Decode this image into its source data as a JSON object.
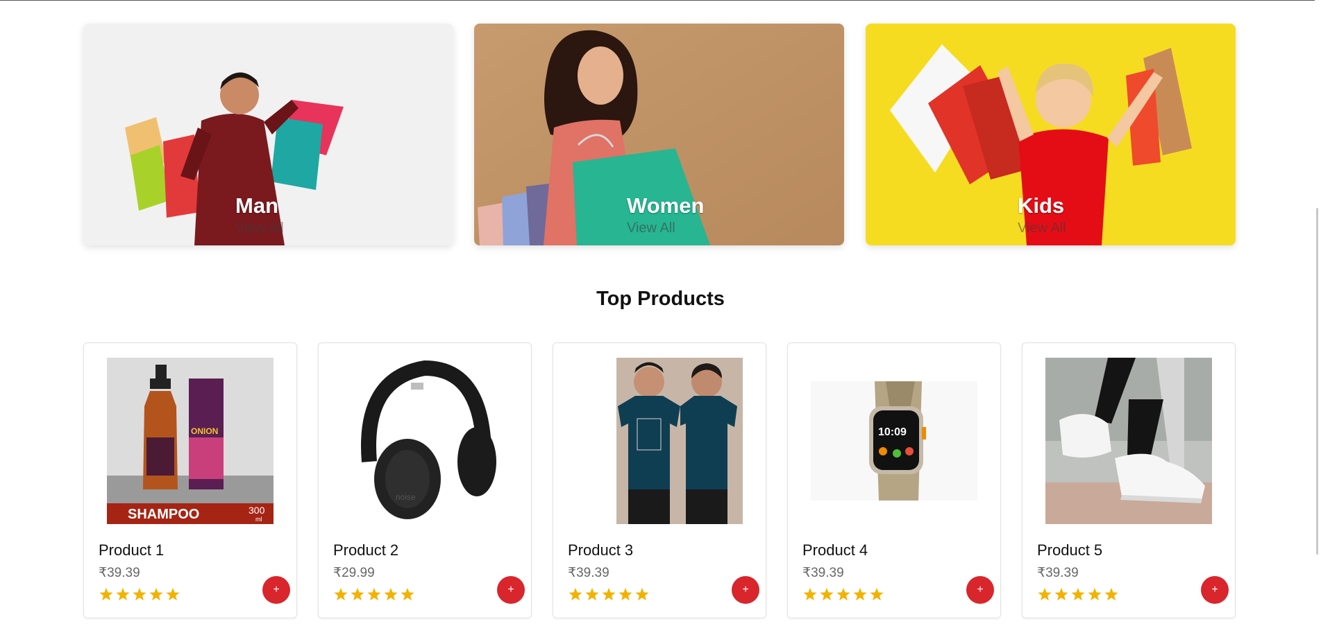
{
  "categories": [
    {
      "title": "Man",
      "link": "View All",
      "bg_color": "#f1f1f1"
    },
    {
      "title": "Women",
      "link": "View All",
      "bg_color": "#c69a6c"
    },
    {
      "title": "Kids",
      "link": "View All",
      "bg_color": "#f6dc21"
    }
  ],
  "section": {
    "title": "Top Products"
  },
  "products": [
    {
      "name": "Product 1",
      "price": "₹39.39",
      "rating": 5,
      "add_label": "+",
      "image_label": "SHAMPOO",
      "image_size": "300",
      "image_unit": "ml",
      "image_brand": "ONION",
      "image_icon": "shampoo-bottle-icon"
    },
    {
      "name": "Product 2",
      "price": "₹29.99",
      "rating": 5,
      "add_label": "+",
      "image_brand": "noise",
      "image_icon": "headphones-icon"
    },
    {
      "name": "Product 3",
      "price": "₹39.39",
      "rating": 5,
      "add_label": "+",
      "image_icon": "tshirt-icon"
    },
    {
      "name": "Product 4",
      "price": "₹39.39",
      "rating": 5,
      "add_label": "+",
      "image_time": "10:09",
      "image_icon": "smartwatch-icon"
    },
    {
      "name": "Product 5",
      "price": "₹39.39",
      "rating": 5,
      "add_label": "+",
      "image_icon": "sneakers-icon"
    }
  ],
  "colors": {
    "accent": "#d9252c",
    "star": "#f2b300",
    "price": "#666666"
  }
}
